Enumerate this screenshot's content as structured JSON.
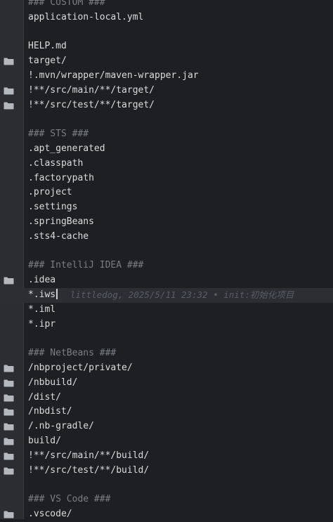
{
  "editor": {
    "lines": [
      {
        "text": "### CUSTOM ###",
        "kind": "comment",
        "folder": false
      },
      {
        "text": "application-local.yml",
        "kind": "text",
        "folder": false
      },
      {
        "text": "",
        "kind": "text",
        "folder": false
      },
      {
        "text": "HELP.md",
        "kind": "text",
        "folder": false
      },
      {
        "text": "target/",
        "kind": "text",
        "folder": true
      },
      {
        "text": "!.mvn/wrapper/maven-wrapper.jar",
        "kind": "text",
        "folder": false
      },
      {
        "text": "!**/src/main/**/target/",
        "kind": "text",
        "folder": true
      },
      {
        "text": "!**/src/test/**/target/",
        "kind": "text",
        "folder": true
      },
      {
        "text": "",
        "kind": "text",
        "folder": false
      },
      {
        "text": "### STS ###",
        "kind": "comment",
        "folder": false
      },
      {
        "text": ".apt_generated",
        "kind": "text",
        "folder": false
      },
      {
        "text": ".classpath",
        "kind": "text",
        "folder": false
      },
      {
        "text": ".factorypath",
        "kind": "text",
        "folder": false
      },
      {
        "text": ".project",
        "kind": "text",
        "folder": false
      },
      {
        "text": ".settings",
        "kind": "text",
        "folder": false
      },
      {
        "text": ".springBeans",
        "kind": "text",
        "folder": false
      },
      {
        "text": ".sts4-cache",
        "kind": "text",
        "folder": false
      },
      {
        "text": "",
        "kind": "text",
        "folder": false
      },
      {
        "text": "### IntelliJ IDEA ###",
        "kind": "comment",
        "folder": false
      },
      {
        "text": ".idea",
        "kind": "text",
        "folder": true
      },
      {
        "text": "*.iws",
        "kind": "text",
        "folder": false,
        "current": true
      },
      {
        "text": "*.iml",
        "kind": "text",
        "folder": false
      },
      {
        "text": "*.ipr",
        "kind": "text",
        "folder": false
      },
      {
        "text": "",
        "kind": "text",
        "folder": false
      },
      {
        "text": "### NetBeans ###",
        "kind": "comment",
        "folder": false
      },
      {
        "text": "/nbproject/private/",
        "kind": "text",
        "folder": true
      },
      {
        "text": "/nbbuild/",
        "kind": "text",
        "folder": true
      },
      {
        "text": "/dist/",
        "kind": "text",
        "folder": true
      },
      {
        "text": "/nbdist/",
        "kind": "text",
        "folder": true
      },
      {
        "text": "/.nb-gradle/",
        "kind": "text",
        "folder": true
      },
      {
        "text": "build/",
        "kind": "text",
        "folder": true
      },
      {
        "text": "!**/src/main/**/build/",
        "kind": "text",
        "folder": true
      },
      {
        "text": "!**/src/test/**/build/",
        "kind": "text",
        "folder": true
      },
      {
        "text": "",
        "kind": "text",
        "folder": false
      },
      {
        "text": "### VS Code ###",
        "kind": "comment",
        "folder": false
      },
      {
        "text": ".vscode/",
        "kind": "text",
        "folder": true
      }
    ],
    "blame_hint": "littledog, 2025/5/11 23:32 • init:初始化项目",
    "colors": {
      "background": "#1e1f22",
      "gutter": "#2b2d30",
      "text": "#dcdcdc",
      "comment": "#7a7e85",
      "folder_icon": "#b4b8bf",
      "current_line": "#2c2e34",
      "hint": "#595d66"
    },
    "icons": {
      "folder": "folder-icon"
    }
  }
}
